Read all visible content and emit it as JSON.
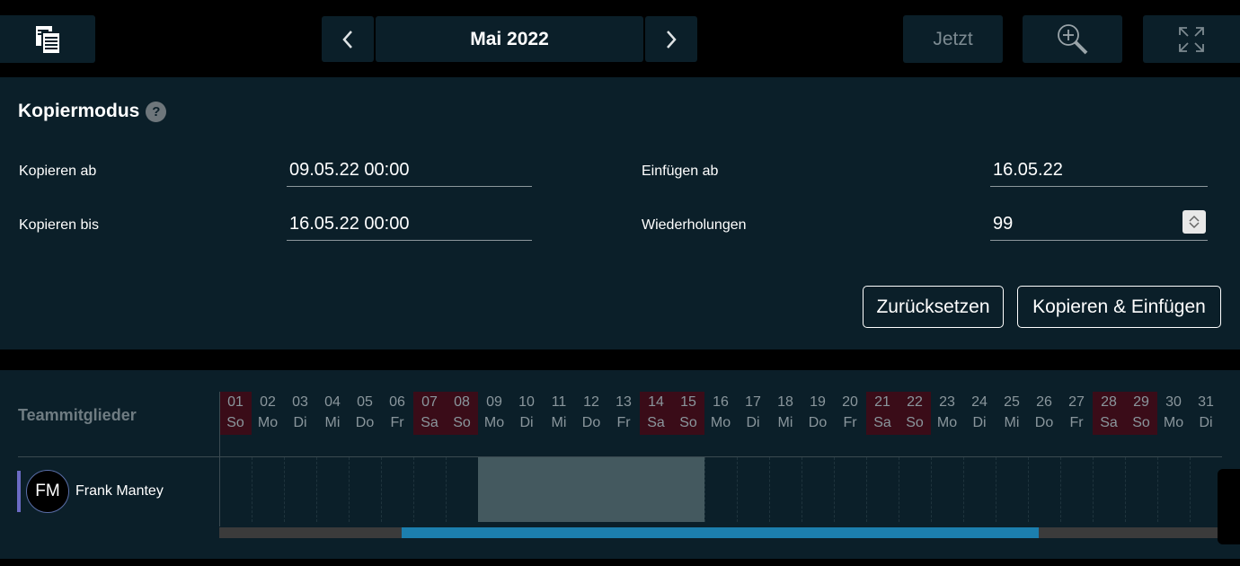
{
  "toolbar": {
    "month": "Mai 2022",
    "now_label": "Jetzt"
  },
  "copy_mode": {
    "title": "Kopiermodus",
    "help_symbol": "?",
    "copy_from_label": "Kopieren ab",
    "copy_from_value": "09.05.22 00:00",
    "copy_to_label": "Kopieren bis",
    "copy_to_value": "16.05.22 00:00",
    "paste_from_label": "Einfügen ab",
    "paste_from_value": "16.05.22",
    "repeat_label": "Wiederholungen",
    "repeat_value": "99",
    "reset_label": "Zurücksetzen",
    "copy_paste_label": "Kopieren & Einfügen"
  },
  "timeline": {
    "team_header": "Teammitglieder",
    "days": [
      {
        "num": "01",
        "wd": "So",
        "weekend": true
      },
      {
        "num": "02",
        "wd": "Mo",
        "weekend": false
      },
      {
        "num": "03",
        "wd": "Di",
        "weekend": false
      },
      {
        "num": "04",
        "wd": "Mi",
        "weekend": false
      },
      {
        "num": "05",
        "wd": "Do",
        "weekend": false
      },
      {
        "num": "06",
        "wd": "Fr",
        "weekend": false
      },
      {
        "num": "07",
        "wd": "Sa",
        "weekend": true
      },
      {
        "num": "08",
        "wd": "So",
        "weekend": true
      },
      {
        "num": "09",
        "wd": "Mo",
        "weekend": false
      },
      {
        "num": "10",
        "wd": "Di",
        "weekend": false
      },
      {
        "num": "11",
        "wd": "Mi",
        "weekend": false
      },
      {
        "num": "12",
        "wd": "Do",
        "weekend": false
      },
      {
        "num": "13",
        "wd": "Fr",
        "weekend": false
      },
      {
        "num": "14",
        "wd": "Sa",
        "weekend": true
      },
      {
        "num": "15",
        "wd": "So",
        "weekend": true
      },
      {
        "num": "16",
        "wd": "Mo",
        "weekend": false
      },
      {
        "num": "17",
        "wd": "Di",
        "weekend": false
      },
      {
        "num": "18",
        "wd": "Mi",
        "weekend": false
      },
      {
        "num": "19",
        "wd": "Do",
        "weekend": false
      },
      {
        "num": "20",
        "wd": "Fr",
        "weekend": false
      },
      {
        "num": "21",
        "wd": "Sa",
        "weekend": true
      },
      {
        "num": "22",
        "wd": "So",
        "weekend": true
      },
      {
        "num": "23",
        "wd": "Mo",
        "weekend": false
      },
      {
        "num": "24",
        "wd": "Di",
        "weekend": false
      },
      {
        "num": "25",
        "wd": "Mi",
        "weekend": false
      },
      {
        "num": "26",
        "wd": "Do",
        "weekend": false
      },
      {
        "num": "27",
        "wd": "Fr",
        "weekend": false
      },
      {
        "num": "28",
        "wd": "Sa",
        "weekend": true
      },
      {
        "num": "29",
        "wd": "So",
        "weekend": true
      },
      {
        "num": "30",
        "wd": "Mo",
        "weekend": false
      },
      {
        "num": "31",
        "wd": "Di",
        "weekend": false
      }
    ],
    "member": {
      "initials": "FM",
      "name": "Frank Mantey"
    },
    "selected_range": {
      "from_day": 9,
      "to_day": 15
    },
    "scroll": {
      "thumb_start": 0.183,
      "thumb_end": 0.82
    }
  },
  "icons": {
    "copy": "copy-icon",
    "prev": "chevron-left-icon",
    "next": "chevron-right-icon",
    "zoom": "zoom-in-icon",
    "fullscreen": "fullscreen-icon"
  }
}
